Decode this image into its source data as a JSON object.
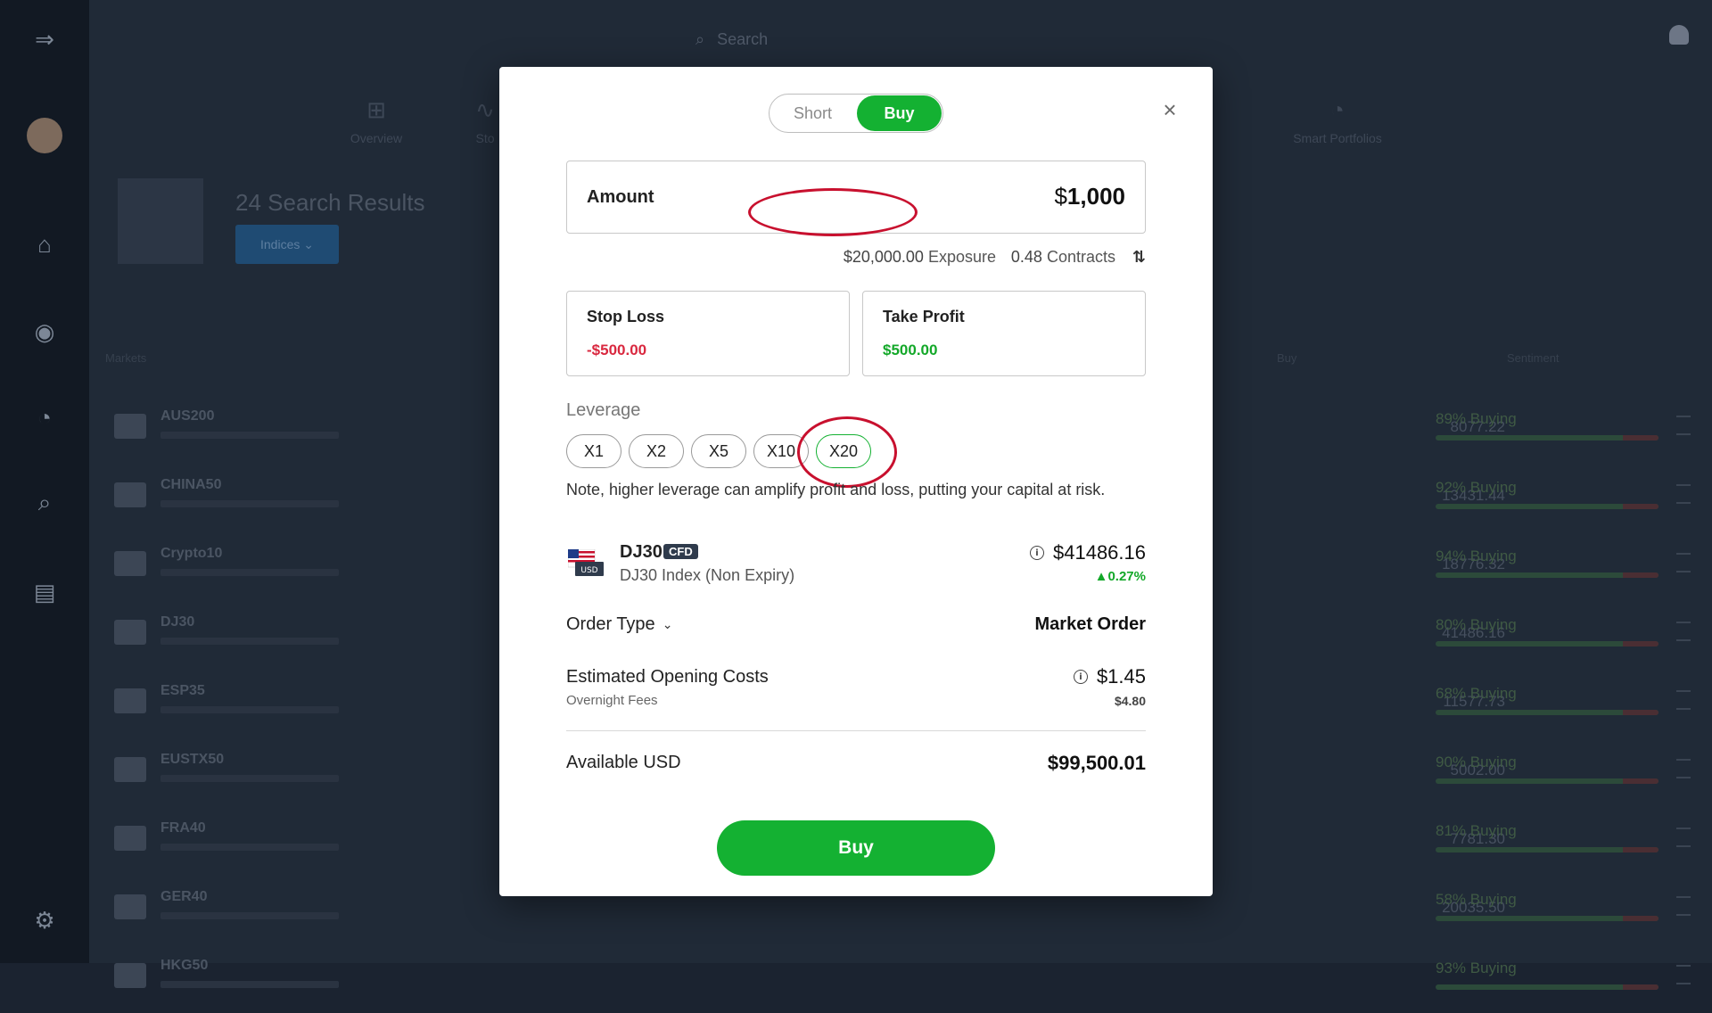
{
  "background": {
    "search_placeholder": "Search",
    "tabs": [
      "Overview",
      "Sto",
      "",
      "Smart Portfolios"
    ],
    "results_title": "24 Search Results",
    "filter_chip": "Indices",
    "columns": [
      "Markets",
      "Buy",
      "Sentiment"
    ],
    "rows": [
      {
        "symbol": "AUS200",
        "price": "8077.22",
        "pct": "89% Buying"
      },
      {
        "symbol": "CHINA50",
        "price": "13431.44",
        "pct": "92% Buying"
      },
      {
        "symbol": "Crypto10",
        "price": "18776.32",
        "pct": "94% Buying"
      },
      {
        "symbol": "DJ30",
        "price": "41486.16",
        "pct": "80% Buying"
      },
      {
        "symbol": "ESP35",
        "price": "11577.73",
        "pct": "68% Buying"
      },
      {
        "symbol": "EUSTX50",
        "price": "5002.00",
        "pct": "90% Buying"
      },
      {
        "symbol": "FRA40",
        "price": "7781.30",
        "pct": "81% Buying"
      },
      {
        "symbol": "GER40",
        "price": "20035.50",
        "pct": "58% Buying"
      },
      {
        "symbol": "HKG50",
        "price": "",
        "pct": "93% Buying"
      }
    ]
  },
  "modal": {
    "toggle": {
      "short": "Short",
      "buy": "Buy"
    },
    "close_glyph": "×",
    "amount": {
      "label": "Amount",
      "currency": "$",
      "value": "1,000"
    },
    "exposure": {
      "value": "$20,000.00",
      "label": "Exposure"
    },
    "contracts": {
      "value": "0.48",
      "label": "Contracts"
    },
    "swap_glyph": "⇅",
    "stop_loss": {
      "label": "Stop Loss",
      "value": "-$500.00"
    },
    "take_profit": {
      "label": "Take Profit",
      "value": "$500.00"
    },
    "leverage": {
      "title": "Leverage",
      "options": [
        "X1",
        "X2",
        "X5",
        "X10",
        "X20"
      ],
      "selected": "X20",
      "note": "Note, higher leverage can amplify profit and loss, putting your capital at risk."
    },
    "instrument": {
      "symbol": "DJ30",
      "badge": "CFD",
      "name": "DJ30 Index (Non Expiry)",
      "price": "$41486.16",
      "change": "▲0.27%",
      "flag_text": "USD"
    },
    "order_type": {
      "label": "Order Type",
      "value": "Market Order"
    },
    "costs": {
      "label": "Estimated Opening Costs",
      "value": "$1.45",
      "fees_label": "Overnight Fees",
      "fees_value": "$4.80"
    },
    "available": {
      "label": "Available USD",
      "value": "$99,500.01"
    },
    "buy_button": "Buy"
  },
  "colors": {
    "accent_green": "#14b132",
    "negative_red": "#d9283f",
    "annotation_red": "#c8102e"
  }
}
